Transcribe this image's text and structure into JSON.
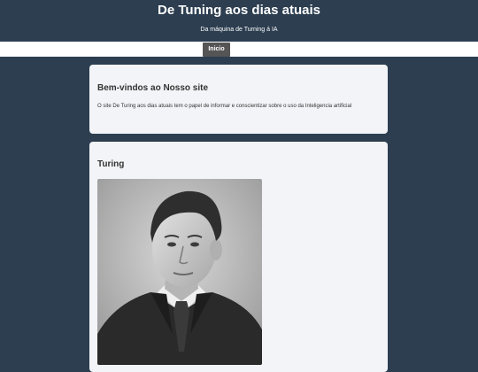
{
  "header": {
    "title": "De Tuning aos dias atuais",
    "subtitle": "Da máquina de Turning á IA"
  },
  "nav": {
    "items": [
      {
        "label": "Inicio"
      }
    ]
  },
  "sections": [
    {
      "heading": "Bem-vindos ao Nosso site",
      "text": "O site De Turing aos dias atuais tem o papel de informar e conscientizar sobre o uso da Inteligencia artificial"
    },
    {
      "heading": "Turing",
      "image": "portrait of Alan Turing"
    }
  ],
  "colors": {
    "page_background": "#2c3e50",
    "nav_background": "#ffffff",
    "nav_button": "#555555",
    "card_background": "#f2f4f7"
  }
}
